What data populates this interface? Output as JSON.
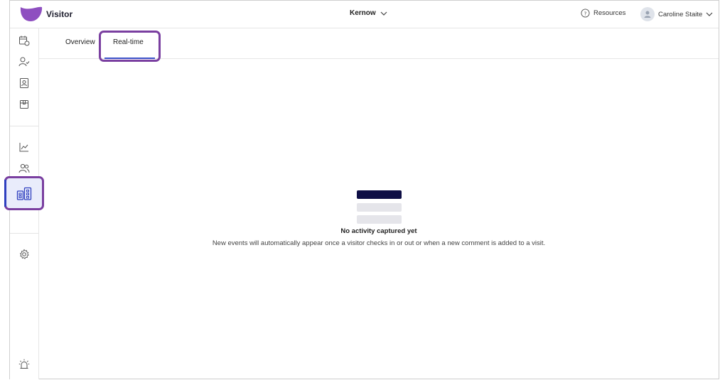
{
  "app": {
    "name": "Visitor",
    "brand_color": "#8e4fc0"
  },
  "header": {
    "site_name": "Kernow",
    "resources_label": "Resources",
    "user_name": "Caroline Staite"
  },
  "sidebar": {
    "active_item": "sidebar-item-realtime-board",
    "items": [
      {
        "name": "calendar-clock-icon"
      },
      {
        "name": "user-check-icon"
      },
      {
        "name": "contact-card-icon"
      },
      {
        "name": "package-icon"
      },
      {
        "name": "line-chart-icon"
      },
      {
        "name": "users-icon"
      },
      {
        "name": "building-icon"
      },
      {
        "name": "settings-icon"
      },
      {
        "name": "alarm-siren-icon"
      }
    ]
  },
  "tabs": [
    {
      "label": "Overview",
      "active": false
    },
    {
      "label": "Real-time",
      "active": true
    }
  ],
  "empty_state": {
    "title": "No activity captured yet",
    "description": "New events will automatically appear once a visitor checks in or out or when a new comment is added to a visit."
  }
}
